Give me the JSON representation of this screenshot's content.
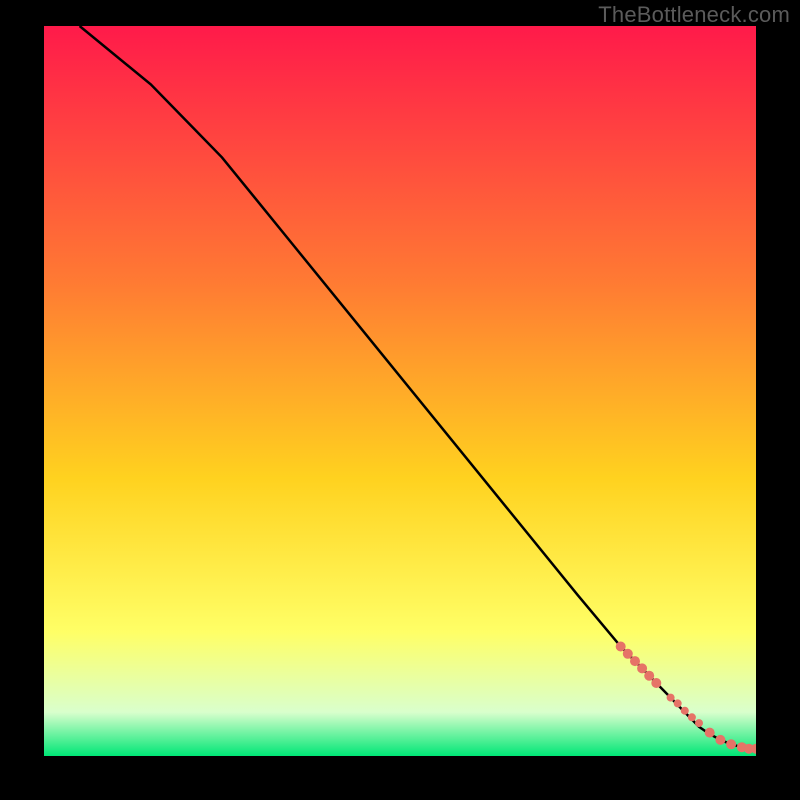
{
  "watermark": "TheBottleneck.com",
  "colors": {
    "bg_black": "#000000",
    "grad_top": "#ff1a4a",
    "grad_mid1": "#ff7a33",
    "grad_mid2": "#ffd21f",
    "grad_mid3": "#ffff66",
    "grad_low": "#d9ffcc",
    "grad_green": "#00e676",
    "line_black": "#000000",
    "point_salmon": "#e67367"
  },
  "chart_data": {
    "type": "line",
    "title": "",
    "xlabel": "",
    "ylabel": "",
    "xlim": [
      0,
      100
    ],
    "ylim": [
      0,
      100
    ],
    "series": [
      {
        "name": "curve",
        "x": [
          5,
          15,
          25,
          30,
          35,
          45,
          55,
          65,
          75,
          81,
          84,
          86,
          88,
          90,
          92,
          93.5,
          95,
          96.5,
          98,
          99,
          100
        ],
        "y": [
          100,
          92,
          82,
          76,
          70,
          58,
          46,
          34,
          22,
          15,
          12,
          10,
          8,
          6,
          4,
          3,
          2.2,
          1.6,
          1.2,
          1.0,
          1.0
        ]
      }
    ],
    "points": {
      "name": "highlight-points",
      "x": [
        81,
        82,
        83,
        84,
        85,
        86,
        88,
        89,
        90,
        91,
        92,
        93.5,
        95,
        96.5,
        98,
        99,
        100
      ],
      "y": [
        15,
        14,
        13,
        12,
        11,
        10,
        8,
        7.2,
        6.2,
        5.3,
        4.5,
        3.2,
        2.2,
        1.6,
        1.2,
        1.0,
        1.0
      ],
      "r": [
        5,
        5,
        5,
        5,
        5,
        5,
        4,
        4,
        4,
        4,
        4,
        5,
        5,
        5,
        5,
        5,
        5
      ]
    }
  }
}
